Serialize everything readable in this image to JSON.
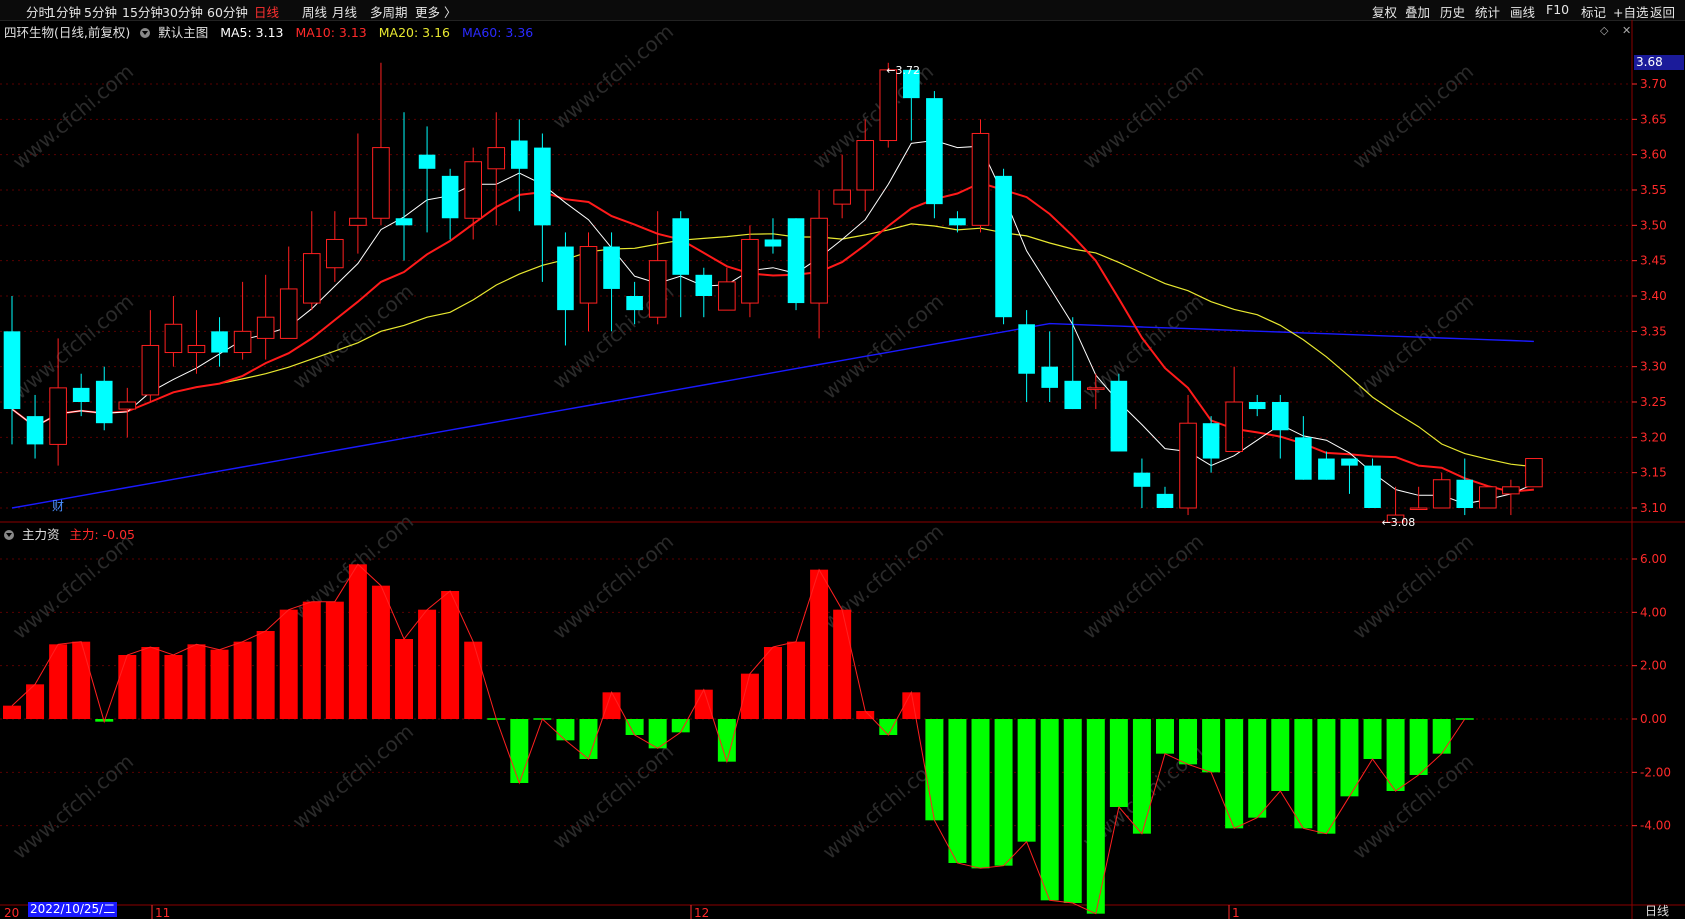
{
  "toolbar": {
    "left_items": [
      "分时",
      "1分钟",
      "5分钟",
      "15分钟",
      "30分钟",
      "60分钟",
      "日线",
      "周线",
      "月线",
      "多周期",
      "更多 〉"
    ],
    "active": "日线",
    "right_items": [
      "复权",
      "叠加",
      "历史",
      "统计",
      "画线",
      "F10",
      "标记",
      "+自选",
      "返回"
    ]
  },
  "main_chart": {
    "stock": "四环生物(日线,前复权)",
    "template": "默认主图",
    "ma5_label": "MA5: 3.13",
    "ma10_label": "MA10: 3.13",
    "ma20_label": "MA20: 3.16",
    "ma60_label": "MA60: 3.36",
    "current_price": "3.68",
    "high_mark": "3.72",
    "low_mark": "3.08",
    "cai_mark": "财"
  },
  "sub_chart": {
    "name": "主力资",
    "value_label": "主力: -0.05"
  },
  "axis": {
    "price_ticks": [
      "3.70",
      "3.65",
      "3.60",
      "3.55",
      "3.50",
      "3.45",
      "3.40",
      "3.35",
      "3.30",
      "3.25",
      "3.20",
      "3.15",
      "3.10"
    ],
    "flow_ticks": [
      "6.00",
      "4.00",
      "2.00",
      "0.00",
      "-2.00",
      "-4.00"
    ],
    "date_badge": "2022/10/25/二",
    "date_prefix": "20",
    "month_labels": [
      "11",
      "12",
      "1"
    ],
    "period": "日线"
  },
  "watermark": "www.cfchi.com",
  "colors": {
    "up": "#ff2020",
    "down": "#00ffff",
    "ma5": "#ffffff",
    "ma10": "#ff1a1a",
    "ma20": "#e8e830",
    "ma60": "#1a1aff",
    "flow_up": "#ff0000",
    "flow_down": "#00ff00"
  },
  "chart_data": {
    "type": "candlestick",
    "candles": [
      [
        3.35,
        3.24,
        3.4,
        3.19
      ],
      [
        3.23,
        3.19,
        3.26,
        3.17
      ],
      [
        3.19,
        3.27,
        3.34,
        3.16
      ],
      [
        3.27,
        3.25,
        3.29,
        3.23
      ],
      [
        3.28,
        3.22,
        3.3,
        3.21
      ],
      [
        3.24,
        3.25,
        3.27,
        3.2
      ],
      [
        3.26,
        3.33,
        3.38,
        3.25
      ],
      [
        3.32,
        3.36,
        3.4,
        3.3
      ],
      [
        3.32,
        3.33,
        3.38,
        3.29
      ],
      [
        3.35,
        3.32,
        3.37,
        3.3
      ],
      [
        3.32,
        3.35,
        3.42,
        3.31
      ],
      [
        3.34,
        3.37,
        3.43,
        3.31
      ],
      [
        3.34,
        3.41,
        3.47,
        3.34
      ],
      [
        3.39,
        3.46,
        3.52,
        3.38
      ],
      [
        3.44,
        3.48,
        3.52,
        3.42
      ],
      [
        3.5,
        3.51,
        3.63,
        3.46
      ],
      [
        3.51,
        3.61,
        3.73,
        3.5
      ],
      [
        3.51,
        3.5,
        3.66,
        3.45
      ],
      [
        3.6,
        3.58,
        3.64,
        3.49
      ],
      [
        3.57,
        3.51,
        3.58,
        3.48
      ],
      [
        3.51,
        3.59,
        3.61,
        3.48
      ],
      [
        3.58,
        3.61,
        3.66,
        3.5
      ],
      [
        3.62,
        3.58,
        3.65,
        3.52
      ],
      [
        3.61,
        3.5,
        3.63,
        3.42
      ],
      [
        3.47,
        3.38,
        3.49,
        3.33
      ],
      [
        3.39,
        3.47,
        3.49,
        3.35
      ],
      [
        3.47,
        3.41,
        3.49,
        3.35
      ],
      [
        3.4,
        3.38,
        3.42,
        3.36
      ],
      [
        3.37,
        3.45,
        3.52,
        3.36
      ],
      [
        3.51,
        3.43,
        3.52,
        3.37
      ],
      [
        3.43,
        3.4,
        3.44,
        3.37
      ],
      [
        3.38,
        3.42,
        3.44,
        3.38
      ],
      [
        3.39,
        3.48,
        3.5,
        3.37
      ],
      [
        3.48,
        3.47,
        3.51,
        3.46
      ],
      [
        3.51,
        3.39,
        3.51,
        3.38
      ],
      [
        3.39,
        3.51,
        3.55,
        3.34
      ],
      [
        3.53,
        3.55,
        3.6,
        3.51
      ],
      [
        3.55,
        3.62,
        3.65,
        3.52
      ],
      [
        3.62,
        3.72,
        3.73,
        3.61
      ],
      [
        3.72,
        3.68,
        3.72,
        3.62
      ],
      [
        3.68,
        3.53,
        3.69,
        3.51
      ],
      [
        3.51,
        3.5,
        3.52,
        3.49
      ],
      [
        3.5,
        3.63,
        3.65,
        3.49
      ],
      [
        3.57,
        3.37,
        3.58,
        3.36
      ],
      [
        3.36,
        3.29,
        3.38,
        3.25
      ],
      [
        3.3,
        3.27,
        3.35,
        3.25
      ],
      [
        3.28,
        3.24,
        3.37,
        3.24
      ],
      [
        3.27,
        3.27,
        3.29,
        3.24
      ],
      [
        3.28,
        3.18,
        3.29,
        3.18
      ],
      [
        3.15,
        3.13,
        3.17,
        3.1
      ],
      [
        3.12,
        3.1,
        3.13,
        3.1
      ],
      [
        3.1,
        3.22,
        3.26,
        3.09
      ],
      [
        3.22,
        3.17,
        3.23,
        3.15
      ],
      [
        3.18,
        3.25,
        3.3,
        3.18
      ],
      [
        3.25,
        3.24,
        3.26,
        3.23
      ],
      [
        3.25,
        3.21,
        3.26,
        3.17
      ],
      [
        3.2,
        3.14,
        3.23,
        3.14
      ],
      [
        3.17,
        3.14,
        3.18,
        3.14
      ],
      [
        3.17,
        3.16,
        3.17,
        3.12
      ],
      [
        3.16,
        3.1,
        3.17,
        3.1
      ],
      [
        3.08,
        3.09,
        3.13,
        3.08
      ],
      [
        3.1,
        3.1,
        3.13,
        3.1
      ],
      [
        3.1,
        3.14,
        3.15,
        3.1
      ],
      [
        3.14,
        3.1,
        3.17,
        3.09
      ],
      [
        3.1,
        3.13,
        3.13,
        3.1
      ],
      [
        3.12,
        3.13,
        3.14,
        3.09
      ],
      [
        3.13,
        3.17,
        3.17,
        3.13
      ]
    ],
    "flow": [
      0.5,
      1.3,
      2.8,
      2.9,
      -0.1,
      2.4,
      2.7,
      2.4,
      2.8,
      2.6,
      2.9,
      3.3,
      4.1,
      4.4,
      4.4,
      5.8,
      5.0,
      3.0,
      4.1,
      4.8,
      2.9,
      0,
      -2.4,
      0,
      -0.8,
      -1.5,
      1.0,
      -0.6,
      -1.1,
      -0.5,
      1.1,
      -1.6,
      1.7,
      2.7,
      2.9,
      5.6,
      4.1,
      0.3,
      -0.6,
      1.0,
      -3.8,
      -5.4,
      -5.6,
      -5.5,
      -4.6,
      -6.8,
      -6.9,
      -7.3,
      -3.3,
      -4.3,
      -1.3,
      -1.7,
      -2.0,
      -4.1,
      -3.7,
      -2.7,
      -4.1,
      -4.3,
      -2.9,
      -1.5,
      -2.7,
      -2.1,
      -1.3,
      0
    ],
    "price_ylim": [
      3.08,
      3.73
    ],
    "flow_ylim": [
      -7.3,
      6.0
    ]
  }
}
